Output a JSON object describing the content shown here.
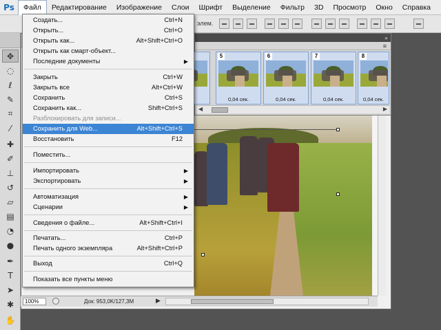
{
  "app": {
    "logo": "Ps"
  },
  "menubar": {
    "items": [
      "Файл",
      "Редактирование",
      "Изображение",
      "Слои",
      "Шрифт",
      "Выделение",
      "Фильтр",
      "3D",
      "Просмотр",
      "Окно",
      "Справка"
    ],
    "active_index": 0
  },
  "optionsbar": {
    "partial_text": "элем."
  },
  "file_menu": {
    "items": [
      {
        "label": "Создать...",
        "shortcut": "Ctrl+N"
      },
      {
        "label": "Открыть...",
        "shortcut": "Ctrl+O"
      },
      {
        "label": "Открыть как...",
        "shortcut": "Alt+Shift+Ctrl+O"
      },
      {
        "label": "Открыть как смарт-объект...",
        "shortcut": ""
      },
      {
        "label": "Последние документы",
        "shortcut": "",
        "submenu": true
      },
      {
        "label": "Закрыть",
        "shortcut": "Ctrl+W"
      },
      {
        "label": "Закрыть все",
        "shortcut": "Alt+Ctrl+W"
      },
      {
        "label": "Сохранить",
        "shortcut": "Ctrl+S"
      },
      {
        "label": "Сохранить как...",
        "shortcut": "Shift+Ctrl+S"
      },
      {
        "label": "Разблокировать для записи...",
        "shortcut": "",
        "disabled": true
      },
      {
        "label": "Сохранить для Web...",
        "shortcut": "Alt+Shift+Ctrl+S",
        "highlighted": true
      },
      {
        "label": "Восстановить",
        "shortcut": "F12"
      },
      {
        "label": "Поместить...",
        "shortcut": ""
      },
      {
        "label": "Импортировать",
        "shortcut": "",
        "submenu": true
      },
      {
        "label": "Экспортировать",
        "shortcut": "",
        "submenu": true
      },
      {
        "label": "Автоматизация",
        "shortcut": "",
        "submenu": true
      },
      {
        "label": "Сценарии",
        "shortcut": "",
        "submenu": true
      },
      {
        "label": "Сведения о файле...",
        "shortcut": "Alt+Shift+Ctrl+I"
      },
      {
        "label": "Печатать...",
        "shortcut": "Ctrl+P"
      },
      {
        "label": "Печать одного экземпляра",
        "shortcut": "Alt+Shift+Ctrl+P"
      },
      {
        "label": "Выход",
        "shortcut": "Ctrl+Q"
      },
      {
        "label": "Показать все пункты меню",
        "shortcut": ""
      }
    ]
  },
  "animation_panel": {
    "frames": [
      {
        "number": "",
        "delay": "сек."
      },
      {
        "number": "5",
        "delay": "0,04 сек."
      },
      {
        "number": "6",
        "delay": "0,04 сек."
      },
      {
        "number": "7",
        "delay": "0,04 сек."
      },
      {
        "number": "8",
        "delay": "0,04 сек."
      }
    ]
  },
  "status_bar": {
    "zoom": "100%",
    "doc_info": "Док: 953,0K/127,3M"
  },
  "colors": {
    "highlight": "#3c84d4",
    "frame_bg": "#cfdcf0",
    "workspace": "#535353"
  },
  "icons": [
    "move-tool-icon",
    "marquee-tool-icon",
    "lasso-tool-icon",
    "quick-select-tool-icon",
    "crop-tool-icon",
    "eyedropper-tool-icon",
    "healing-brush-tool-icon",
    "brush-tool-icon",
    "clone-stamp-tool-icon",
    "history-brush-tool-icon",
    "eraser-tool-icon",
    "gradient-tool-icon",
    "blur-tool-icon",
    "dodge-tool-icon",
    "pen-tool-icon",
    "type-tool-icon",
    "path-select-tool-icon",
    "shape-tool-icon",
    "hand-tool-icon"
  ]
}
